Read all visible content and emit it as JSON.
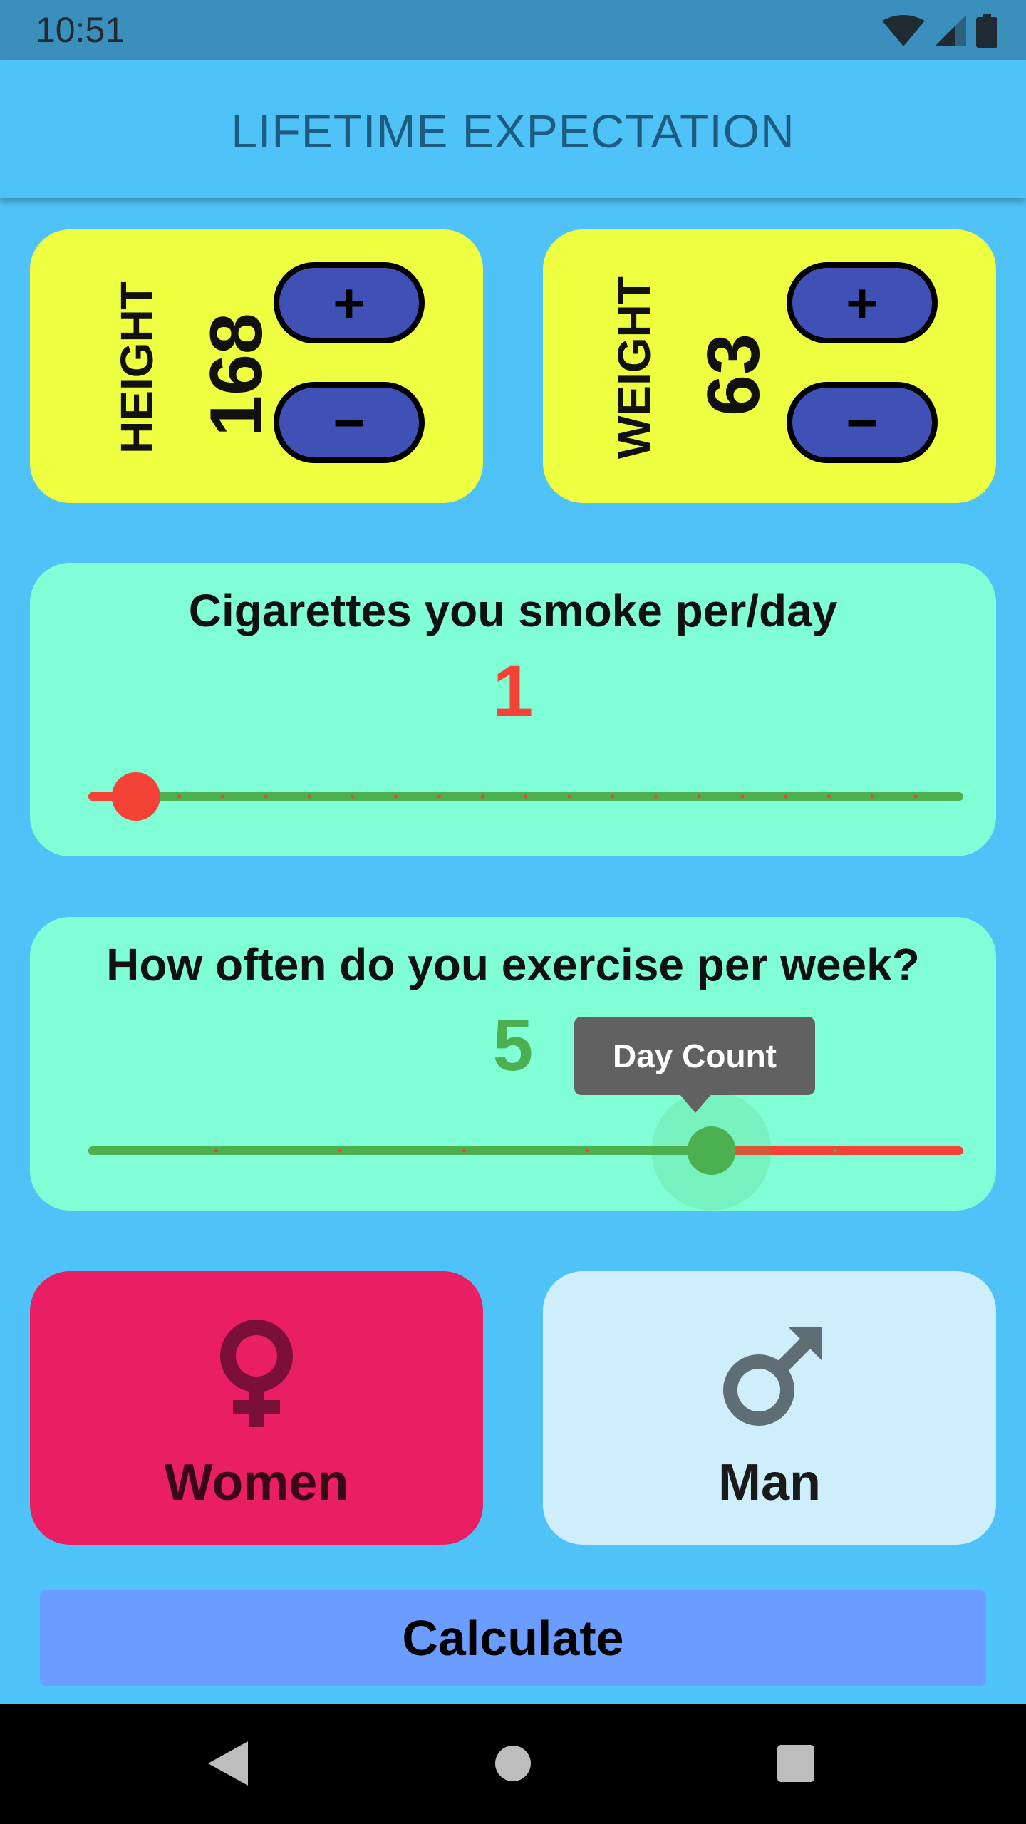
{
  "status_bar": {
    "time": "10:51"
  },
  "app_bar": {
    "title": "LIFETIME EXPECTATION"
  },
  "height_card": {
    "label": "HEIGHT",
    "value": "168",
    "plus_label": "+",
    "minus_label": "−"
  },
  "weight_card": {
    "label": "WEIGHT",
    "value": "63",
    "plus_label": "+",
    "minus_label": "−"
  },
  "cigarettes": {
    "title": "Cigarettes you smoke per/day",
    "value": "1",
    "slider": {
      "min": 0,
      "max": 20,
      "value": 1,
      "divisions": 20
    },
    "value_color": "#f44336"
  },
  "exercise": {
    "title": "How often do you exercise per week?",
    "value": "5",
    "tooltip": "Day Count",
    "slider": {
      "min": 0,
      "max": 7,
      "value": 5,
      "divisions": 7
    },
    "value_color": "#4caf50"
  },
  "gender": {
    "women_label": "Women",
    "man_label": "Man",
    "women_icon": "female-symbol-icon",
    "man_icon": "male-symbol-icon",
    "selected": "women"
  },
  "calculate_label": "Calculate",
  "colors": {
    "background": "#4fc3f7",
    "yellow_card": "#eeff41",
    "aqua_card": "#80ffd6",
    "button_blue": "#3f51b5",
    "women_selected": "#e91e63",
    "man_unselected": "#cfeefc",
    "slider_active": "#4caf50",
    "slider_inactive": "#f44336",
    "calculate_button": "#6b9cff"
  },
  "nav_bar": {
    "back_icon": "back-triangle-icon",
    "home_icon": "home-circle-icon",
    "recents_icon": "recents-square-icon"
  }
}
